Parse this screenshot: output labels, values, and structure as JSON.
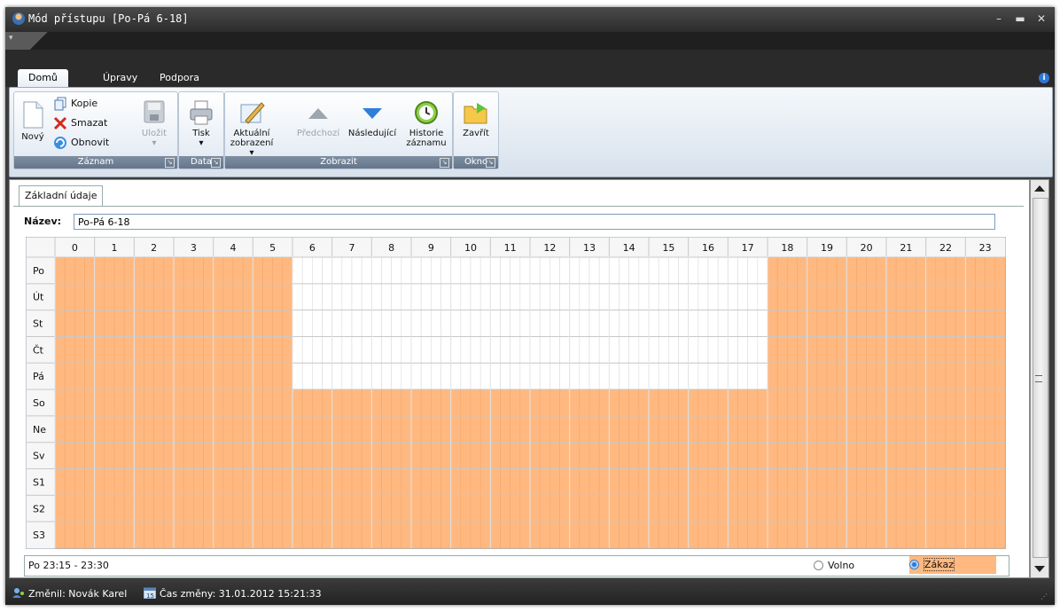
{
  "window": {
    "title": "Mód přístupu [Po-Pá 6-18]"
  },
  "ribbon_tabs": [
    "Domů",
    "Úpravy",
    "Podpora"
  ],
  "groups": {
    "zaznam": {
      "label": "Záznam",
      "novy": "Nový",
      "kopie": "Kopie",
      "smazat": "Smazat",
      "obnovit": "Obnovit",
      "ulozit": "Uložit"
    },
    "data": {
      "label": "Data",
      "tisk": "Tisk"
    },
    "zobrazit": {
      "label": "Zobrazit",
      "aktualni_1": "Aktuální",
      "aktualni_2": "zobrazení",
      "predchozi": "Předchozí",
      "nasledujici": "Následující",
      "historie_1": "Historie",
      "historie_2": "záznamu"
    },
    "okno": {
      "label": "Okno",
      "zavrit": "Zavřít"
    }
  },
  "content": {
    "tab": "Základní údaje",
    "name_label": "Název:",
    "name_value": "Po-Pá 6-18"
  },
  "schedule": {
    "hours": [
      "0",
      "1",
      "2",
      "3",
      "4",
      "5",
      "6",
      "7",
      "8",
      "9",
      "10",
      "11",
      "12",
      "13",
      "14",
      "15",
      "16",
      "17",
      "18",
      "19",
      "20",
      "21",
      "22",
      "23"
    ],
    "rows": [
      "Po",
      "Út",
      "St",
      "Čt",
      "Pá",
      "So",
      "Ne",
      "Sv",
      "S1",
      "S2",
      "S3"
    ],
    "slots_per_hour": 4,
    "allowed": [
      {
        "row": "Po",
        "from_hour": 6,
        "to_hour": 18
      },
      {
        "row": "Út",
        "from_hour": 6,
        "to_hour": 18
      },
      {
        "row": "St",
        "from_hour": 6,
        "to_hour": 18
      },
      {
        "row": "Čt",
        "from_hour": 6,
        "to_hour": 18
      },
      {
        "row": "Pá",
        "from_hour": 6,
        "to_hour": 18
      }
    ],
    "colors": {
      "forbidden": "#ffb980",
      "free": "#ffffff",
      "grid_line": "#d8d8d8"
    }
  },
  "status": {
    "selection": "Po 23:15 - 23:30",
    "radio_free": "Volno",
    "radio_forbidden": "Zákaz"
  },
  "bottombar": {
    "changed_by": "Změnil: Novák Karel",
    "changed_time": "Čas změny: 31.01.2012 15:21:33"
  }
}
